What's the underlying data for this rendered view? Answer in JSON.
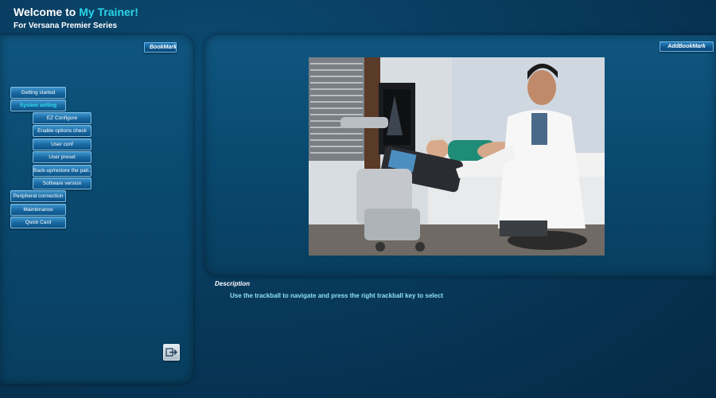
{
  "header": {
    "title_prefix": "Welcome to ",
    "title_accent": "My Trainer!",
    "subtitle": "For Versana Premier Series"
  },
  "left_panel": {
    "bookmark_label": "BookMark",
    "menu": [
      {
        "label": "Getting started",
        "level": 1
      },
      {
        "label": "System setting",
        "level": 1,
        "selected": true
      },
      {
        "label": "EZ Configure",
        "level": 2
      },
      {
        "label": "Enable options check",
        "level": 2
      },
      {
        "label": "User conf",
        "level": 2
      },
      {
        "label": "User preset",
        "level": 2
      },
      {
        "label": "Back-up/restore  the  pati...",
        "level": 2
      },
      {
        "label": "Software version",
        "level": 2
      },
      {
        "label": "Peripheral connection",
        "level": 1
      },
      {
        "label": "Maintenance",
        "level": 1
      },
      {
        "label": "Quick Card",
        "level": 1
      }
    ],
    "exit_icon": "exit-icon"
  },
  "right_panel": {
    "add_bookmark_label": "AddBookMark",
    "image_subject": "ultrasound-exam-photo"
  },
  "description": {
    "title": "Description",
    "text": "Use the trackball to navigate and press the right trackball key to select"
  },
  "colors": {
    "accent": "#29d6e8",
    "background": "#083a5c",
    "description_text": "#8fe1f0"
  }
}
